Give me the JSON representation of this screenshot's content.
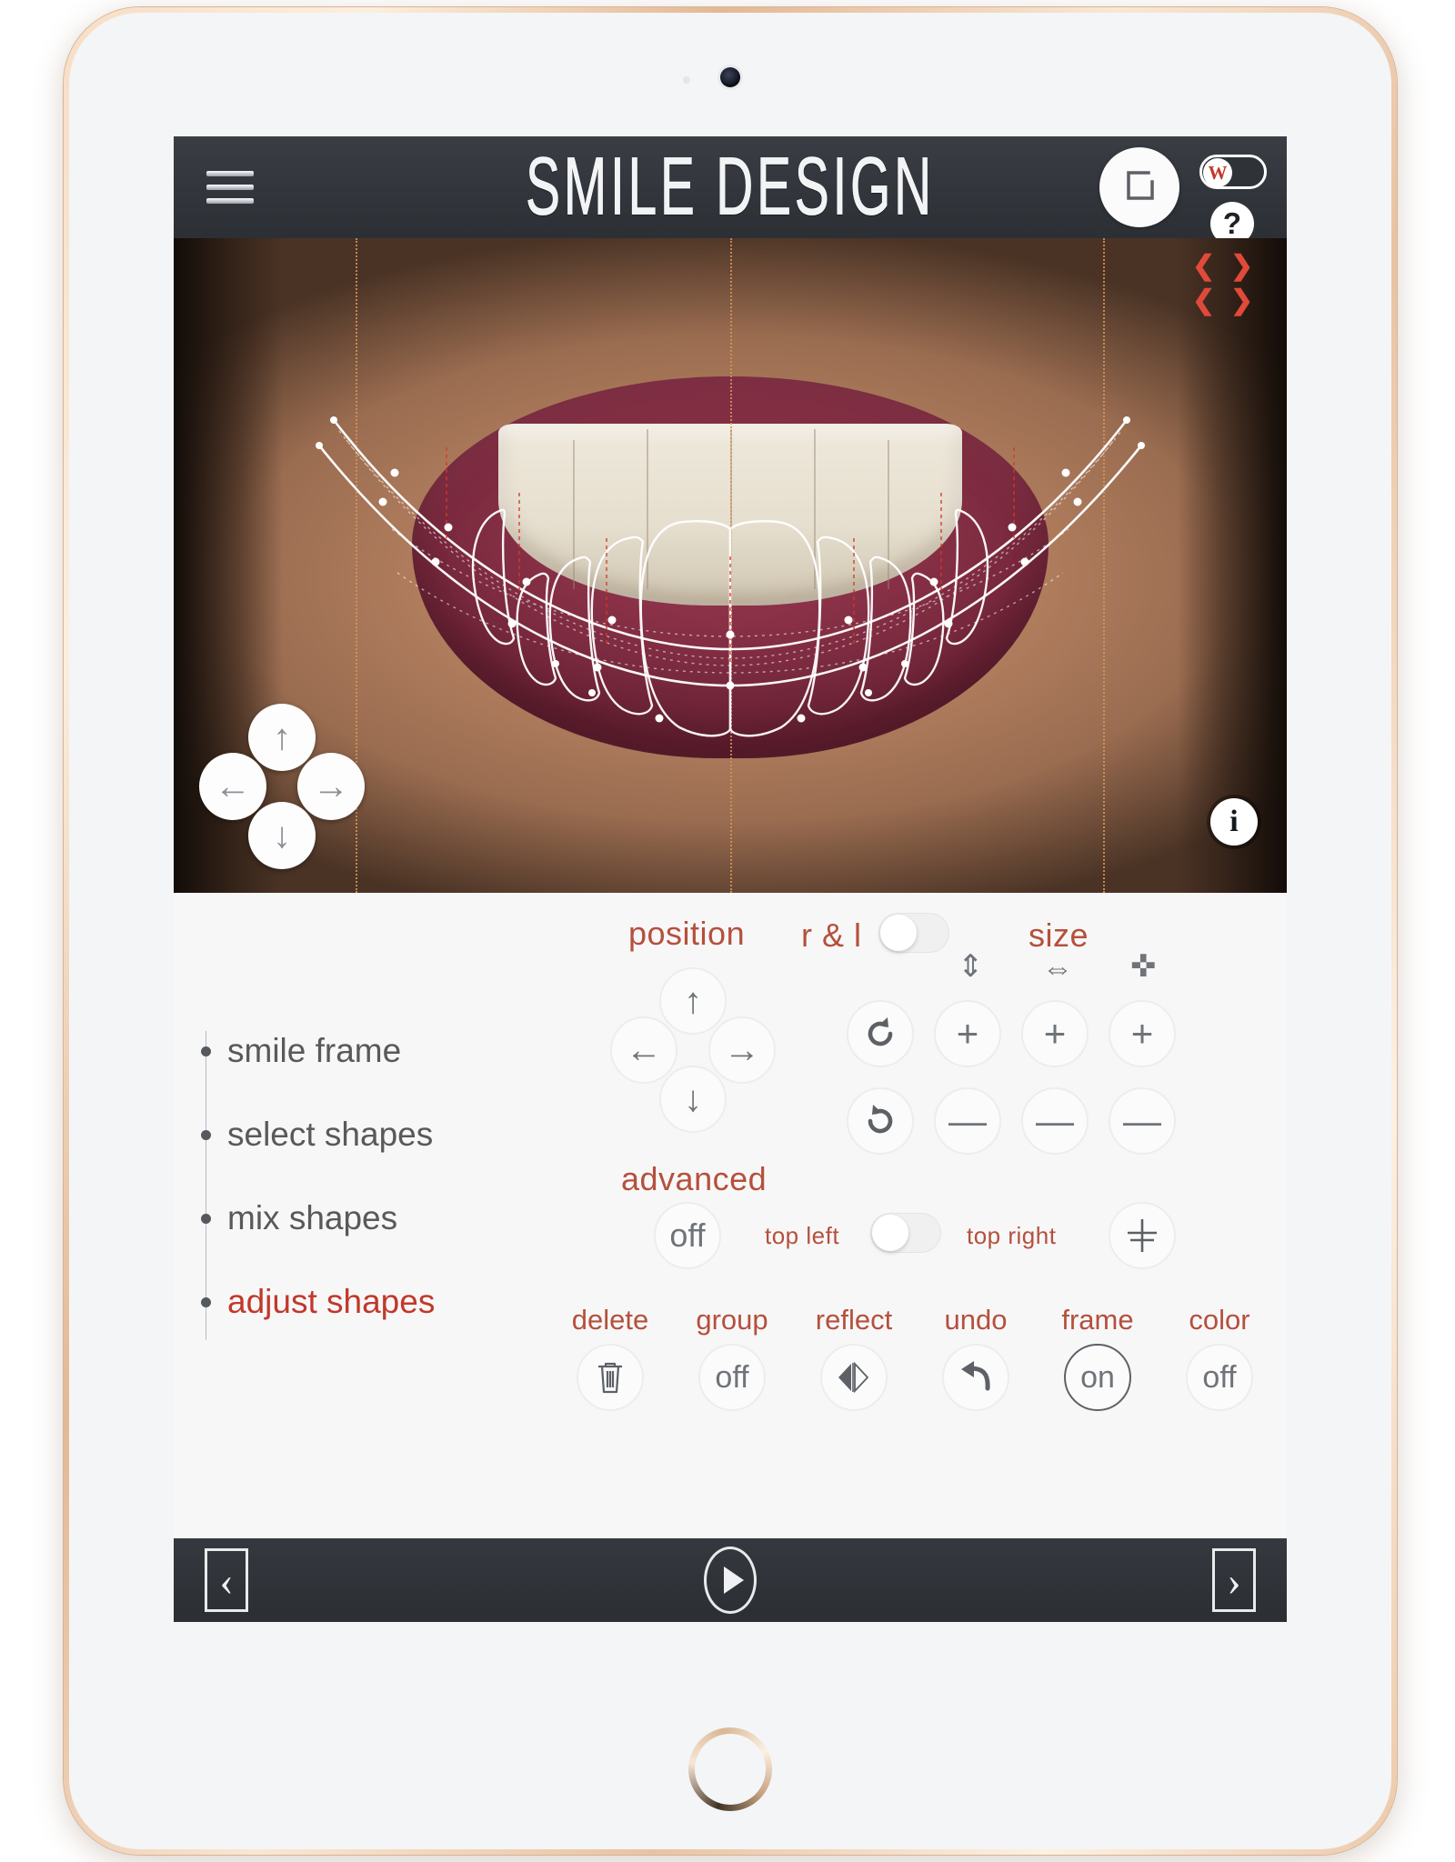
{
  "app": {
    "title": "SMILE DESIGN",
    "menu_icon": "hamburger-icon",
    "crop_icon": "crop-frame-icon",
    "w_badge_label": "W",
    "help_label": "?"
  },
  "canvas": {
    "collapse_icon": "collapse-arrows-icon",
    "info_label": "i",
    "dpad": {
      "up": "↑",
      "down": "↓",
      "left": "←",
      "right": "→"
    }
  },
  "steps": [
    {
      "label": "smile frame",
      "active": false
    },
    {
      "label": "select shapes",
      "active": false
    },
    {
      "label": "mix shapes",
      "active": false
    },
    {
      "label": "adjust shapes",
      "active": true
    }
  ],
  "panel": {
    "position_label": "position",
    "rl_label": "r & l",
    "rl_value": "off",
    "size_label": "size",
    "advanced_label": "advanced",
    "advanced_value": "off",
    "top_left_label": "top left",
    "top_right_label": "top right",
    "corner_toggle_value": "off",
    "dpad": {
      "up": "↑",
      "down": "↓",
      "left": "←",
      "right": "→"
    },
    "axis_icons": {
      "height": "⇕",
      "width": "⇔",
      "both": "✜"
    },
    "rotate_cw": "↻",
    "rotate_ccw": "↺",
    "plus": "+",
    "minus": "—",
    "cross": "†"
  },
  "actions": [
    {
      "caption": "delete",
      "value": "",
      "icon": "trash-icon",
      "state": "normal"
    },
    {
      "caption": "group",
      "value": "off",
      "icon": "",
      "state": "normal"
    },
    {
      "caption": "reflect",
      "value": "",
      "icon": "mirror-icon",
      "state": "normal"
    },
    {
      "caption": "undo",
      "value": "",
      "icon": "undo-arrow-icon",
      "state": "normal"
    },
    {
      "caption": "frame",
      "value": "on",
      "icon": "",
      "state": "active"
    },
    {
      "caption": "color",
      "value": "off",
      "icon": "",
      "state": "normal"
    }
  ],
  "bottom_nav": {
    "prev": "‹",
    "play": "play-icon",
    "next": "›"
  },
  "colors": {
    "accent": "#b5503c",
    "active_step": "#c0392b",
    "topbar": "#32363c",
    "panel_bg": "#f7f7f8",
    "guide": "#d6945c",
    "collapse_arrow": "#e04a3a"
  }
}
